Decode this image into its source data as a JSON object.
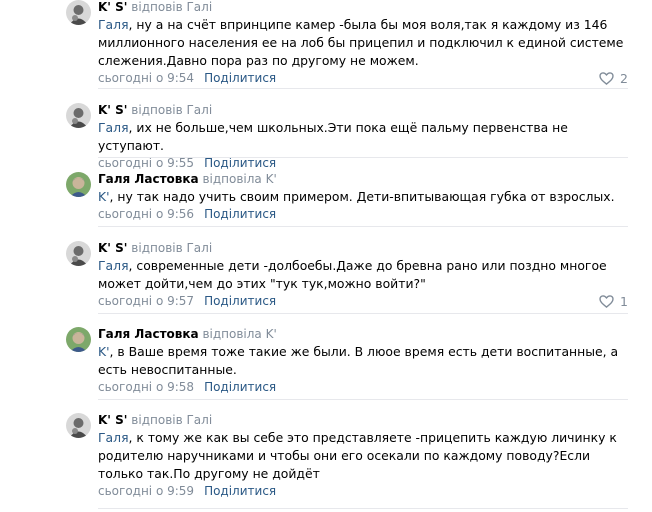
{
  "comments": [
    {
      "author": "K' S'",
      "reply_to": "відповів Галі",
      "mention": "Галя",
      "text": ", ну а на счёт впринципе камер -была бы моя воля,так я каждому из 146 миллионного населения ее на лоб бы прицепил и подключил к единой системе слежения.Давно пора раз по другому не можем.",
      "time": "сьогодні о 9:54",
      "share": "Поділитися",
      "likes": "2"
    },
    {
      "author": "K' S'",
      "reply_to": "відповів Галі",
      "mention": "Галя",
      "text": ", их не больше,чем школьных.Эти пока ещё пальму первенства не уступают.",
      "time": "сьогодні о 9:55",
      "share": "Поділитися",
      "likes": ""
    },
    {
      "author": "Галя Ластовка",
      "reply_to": "відповіла K'",
      "mention": "K'",
      "text": ", ну так надо учить своим примером. Дети-впитывающая губка от взрослых.",
      "time": "сьогодні о 9:56",
      "share": "Поділитися",
      "likes": ""
    },
    {
      "author": "K' S'",
      "reply_to": "відповів Галі",
      "mention": "Галя",
      "text": ", современные дети -долбоебы.Даже до бревна рано или поздно многое может дойти,чем до этих \"тук тук,можно войти?\"",
      "time": "сьогодні о 9:57",
      "share": "Поділитися",
      "likes": "1"
    },
    {
      "author": "Галя Ластовка",
      "reply_to": "відповіла K'",
      "mention": "K'",
      "text": ", в Ваше время тоже такие же были. В люое время есть дети воспитанные, а есть невоспитанные.",
      "time": "сьогодні о 9:58",
      "share": "Поділитися",
      "likes": ""
    },
    {
      "author": "K' S'",
      "reply_to": "відповів Галі",
      "mention": "Галя",
      "text": ", к тому же как вы себе это представляете -прицепить каждую личинку к родителю наручниками и чтобы они его осекали по каждому поводу?Если только так.По другому не дойдёт",
      "time": "сьогодні о 9:59",
      "share": "Поділитися",
      "likes": ""
    }
  ],
  "colors": {
    "link": "#2a5885",
    "meta": "#818c99",
    "divider": "#e7e8ec"
  },
  "icons": {
    "avatar_ks": "avatar-ks-icon",
    "avatar_galya": "avatar-galya-icon",
    "like": "heart-icon"
  }
}
